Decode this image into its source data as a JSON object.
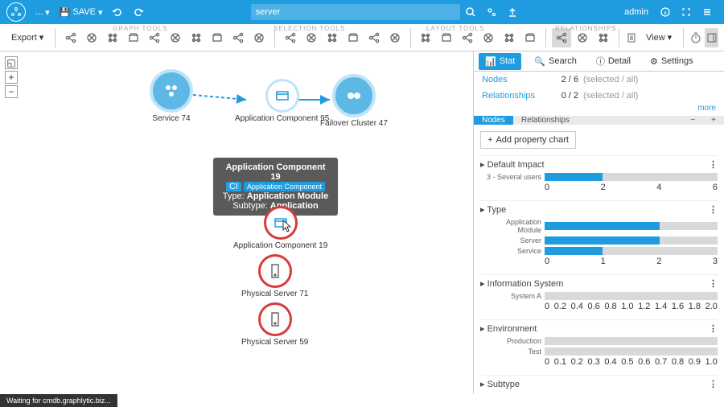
{
  "top": {
    "save": "SAVE",
    "search_val": "server",
    "user": "admin"
  },
  "tool_sections": {
    "graph": "GRAPH TOOLS",
    "selection": "SELECTION TOOLS",
    "layout": "LAYOUT TOOLS",
    "rel": "RELATIONSHIPS"
  },
  "export": "Export",
  "view": "View",
  "canvas_nodes": {
    "n1": "Service 74",
    "n2": "Application Component 95",
    "n3": "Failover Cluster 47",
    "n4": "Application Component 19",
    "n5": "Physical Server 71",
    "n6": "Physical Server 59"
  },
  "tooltip": {
    "title": "Application Component 19",
    "badge_pre": "CI",
    "badge": "Application Component",
    "type_l": "Type:",
    "type_v": "Application Module",
    "sub_l": "Subtype:",
    "sub_v": "Application"
  },
  "panel": {
    "tabs": {
      "stat": "Stat",
      "search": "Search",
      "detail": "Detail",
      "settings": "Settings"
    },
    "stats": {
      "nodes_k": "Nodes",
      "nodes_v": "2 / 6",
      "rel_k": "Relationships",
      "rel_v": "0 / 2",
      "desc": "(selected / all)",
      "more": "more"
    },
    "subtabs": {
      "nodes": "Nodes",
      "rels": "Relationships"
    },
    "add": "Add property chart"
  },
  "chart_data": [
    {
      "type": "bar",
      "title": "Default Impact",
      "categories": [
        "3 - Several users"
      ],
      "values": [
        2
      ],
      "xlim": [
        0,
        6
      ],
      "ticks": [
        "0",
        "2",
        "4",
        "6"
      ]
    },
    {
      "type": "bar",
      "title": "Type",
      "categories": [
        "Application Module",
        "Server",
        "Service"
      ],
      "values": [
        2,
        2,
        1
      ],
      "xlim": [
        0,
        3
      ],
      "ticks": [
        "0",
        "1",
        "2",
        "3"
      ]
    },
    {
      "type": "bar",
      "title": "Information System",
      "categories": [
        "System A"
      ],
      "values": [
        0
      ],
      "xlim": [
        0,
        2.0
      ],
      "ticks": [
        "0",
        "0.2",
        "0.4",
        "0.6",
        "0.8",
        "1.0",
        "1.2",
        "1.4",
        "1.6",
        "1.8",
        "2.0"
      ]
    },
    {
      "type": "bar",
      "title": "Environment",
      "categories": [
        "Production",
        "Test"
      ],
      "values": [
        0,
        0
      ],
      "xlim": [
        0,
        1.0
      ],
      "ticks": [
        "0",
        "0.1",
        "0.2",
        "0.3",
        "0.4",
        "0.5",
        "0.6",
        "0.7",
        "0.8",
        "0.9",
        "1.0"
      ]
    },
    {
      "type": "bar",
      "title": "Subtype",
      "categories": [],
      "values": [],
      "xlim": [
        0,
        1
      ],
      "ticks": []
    }
  ],
  "status": "Waiting for cmdb.graphlytic.biz..."
}
